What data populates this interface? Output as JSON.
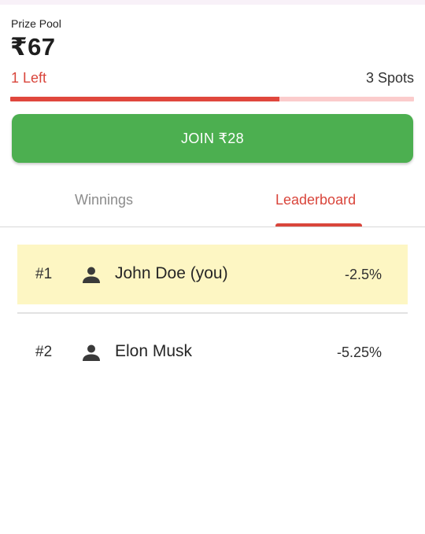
{
  "prize_pool": {
    "label": "Prize Pool",
    "amount": "₹67"
  },
  "spots": {
    "left_label": "1 Left",
    "total_label": "3 Spots",
    "filled_fraction": 0.667
  },
  "join_button": {
    "label": "JOIN ₹28"
  },
  "tabs": [
    {
      "label": "Winnings",
      "active": false
    },
    {
      "label": "Leaderboard",
      "active": true
    }
  ],
  "leaderboard": [
    {
      "rank": "#1",
      "name": "John Doe (you)",
      "change": "-2.5%",
      "highlighted": true
    },
    {
      "rank": "#2",
      "name": "Elon Musk",
      "change": "-5.25%",
      "highlighted": false
    }
  ],
  "colors": {
    "accent_red": "#d9453b",
    "join_green": "#4caf50",
    "highlight_yellow": "#fdf6c3",
    "progress_track": "#fbcccc"
  },
  "icons": {
    "user": "person-icon"
  }
}
